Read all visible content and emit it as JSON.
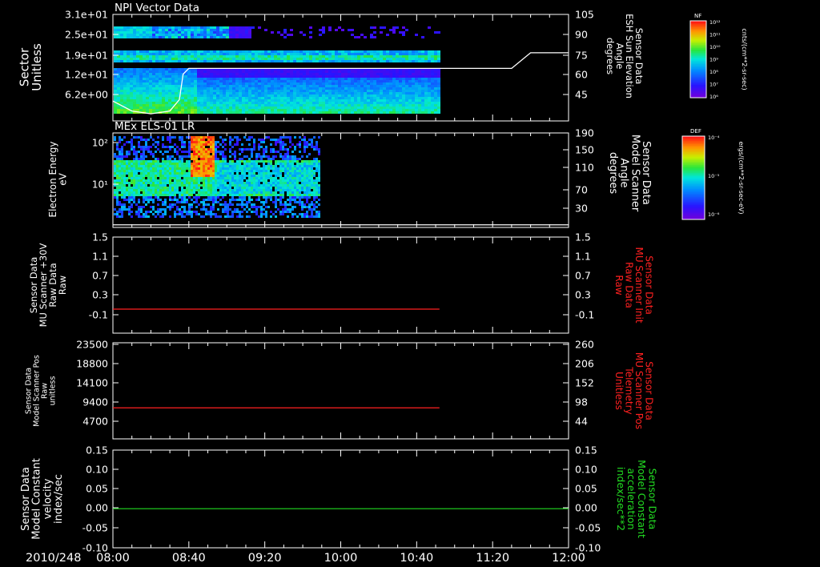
{
  "figure": {
    "date_label": "2010/248",
    "time_ticks": [
      "08:00",
      "08:40",
      "09:20",
      "10:00",
      "10:40",
      "11:20",
      "12:00"
    ]
  },
  "colors": {
    "background": "#000000",
    "axis": "#ffffff",
    "mu_traces": "#ff2020",
    "constant_trace": "#22dd22",
    "elevation_trace": "#ffffff"
  },
  "chart_data": [
    {
      "type": "heatmap",
      "title": "NPI Vector Data",
      "ylabel": [
        "Sector",
        "Unitless"
      ],
      "yticks": [
        "3.1e+01",
        "2.5e+01",
        "1.9e+01",
        "1.2e+01",
        "6.2e+00"
      ],
      "y2label": [
        "Sensor Data",
        "ESH Sun Elevation",
        "Angle",
        "degrees"
      ],
      "y2ticks": [
        "105",
        "90",
        "75",
        "60",
        "45"
      ],
      "y2lim": [
        30,
        105
      ],
      "data_end_time": "10:51",
      "series": [
        {
          "name": "Sensor Data ESH Sun Elevation Angle",
          "type": "line",
          "x": [
            "08:00",
            "08:10",
            "08:20",
            "08:30",
            "08:35",
            "08:37",
            "08:40",
            "09:00",
            "10:00",
            "11:00",
            "11:30",
            "11:40",
            "12:00"
          ],
          "values": [
            44,
            37,
            35,
            37,
            45,
            63,
            67,
            67,
            67,
            67,
            67,
            78,
            78
          ]
        }
      ],
      "colorbar": {
        "label": "NF",
        "units": "cnts/(cm**2-sr-sec)",
        "ticks": [
          "10¹²",
          "10¹¹",
          "10¹⁰",
          "10⁹",
          "10⁸",
          "10⁷",
          "10⁶"
        ]
      }
    },
    {
      "type": "heatmap",
      "title": "MEx ELS-01 LR",
      "ylabel": [
        "Electron Energy",
        "eV"
      ],
      "yticks": [
        "10²",
        "10¹"
      ],
      "y2label": [
        "Sensor Data",
        "Model Scanner",
        "Angle",
        "degrees"
      ],
      "y2ticks": [
        "190",
        "150",
        "110",
        "70",
        "30"
      ],
      "y2lim": [
        10,
        190
      ],
      "data_end_time": "09:49",
      "series": [
        {
          "name": "Sensor Data Model Scanner Angle",
          "type": "line",
          "x": [
            "08:00",
            "12:00"
          ],
          "values": [
            15,
            15
          ]
        }
      ],
      "colorbar": {
        "label": "DEF",
        "units": "ergs/(cm**2-sr-sec-eV)",
        "ticks": [
          "10⁻⁴",
          "10⁻⁵",
          "10⁻⁶"
        ]
      }
    },
    {
      "type": "line",
      "ylabel": [
        "Sensor Data",
        "MU Scanner +30V",
        "Raw Data",
        "Raw"
      ],
      "yticks": [
        "1.5",
        "1.1",
        "0.7",
        "0.3",
        "-0.1"
      ],
      "ylim": [
        -0.5,
        1.5
      ],
      "y2label": [
        "Sensor Data",
        "MU Scanner Init",
        "Raw Data",
        "Raw"
      ],
      "y2ticks": [
        "1.5",
        "1.1",
        "0.7",
        "0.3",
        "-0.1"
      ],
      "y2lim": [
        -0.5,
        1.5
      ],
      "series": [
        {
          "name": "Sensor Data MU Scanner Init Raw Data",
          "x": [
            "08:00",
            "10:52"
          ],
          "values": [
            0,
            0
          ]
        }
      ]
    },
    {
      "type": "line",
      "ylabel": [
        "Sensor Data",
        "Model Scanner Pos",
        "Raw",
        "unitless"
      ],
      "yticks": [
        "23500",
        "18800",
        "14100",
        "9400",
        "4700"
      ],
      "ylim": [
        0,
        23500
      ],
      "y2label": [
        "Sensor Data",
        "MU Scanner Pos",
        "Telemetry",
        "Unitless"
      ],
      "y2ticks": [
        "260",
        "206",
        "152",
        "98",
        "44"
      ],
      "y2lim": [
        0,
        260
      ],
      "series": [
        {
          "name": "Sensor Data MU Scanner Pos Telemetry",
          "x": [
            "08:00",
            "10:52"
          ],
          "values": [
            84,
            84
          ]
        }
      ]
    },
    {
      "type": "line",
      "ylabel": [
        "Sensor Data",
        "Model Constant",
        "velocity",
        "index/sec"
      ],
      "yticks": [
        "0.15",
        "0.10",
        "0.05",
        "0.00",
        "-0.05",
        "-0.10"
      ],
      "ylim": [
        -0.1,
        0.15
      ],
      "y2label": [
        "Sensor Data",
        "Model Constant",
        "acceleration",
        "index/sec**2"
      ],
      "y2ticks": [
        "0.15",
        "0.10",
        "0.05",
        "0.00",
        "-0.05",
        "-0.10"
      ],
      "y2lim": [
        -0.1,
        0.15
      ],
      "series": [
        {
          "name": "Sensor Data Model Constant acceleration",
          "x": [
            "08:00",
            "12:00"
          ],
          "values": [
            0,
            0
          ]
        }
      ]
    }
  ]
}
